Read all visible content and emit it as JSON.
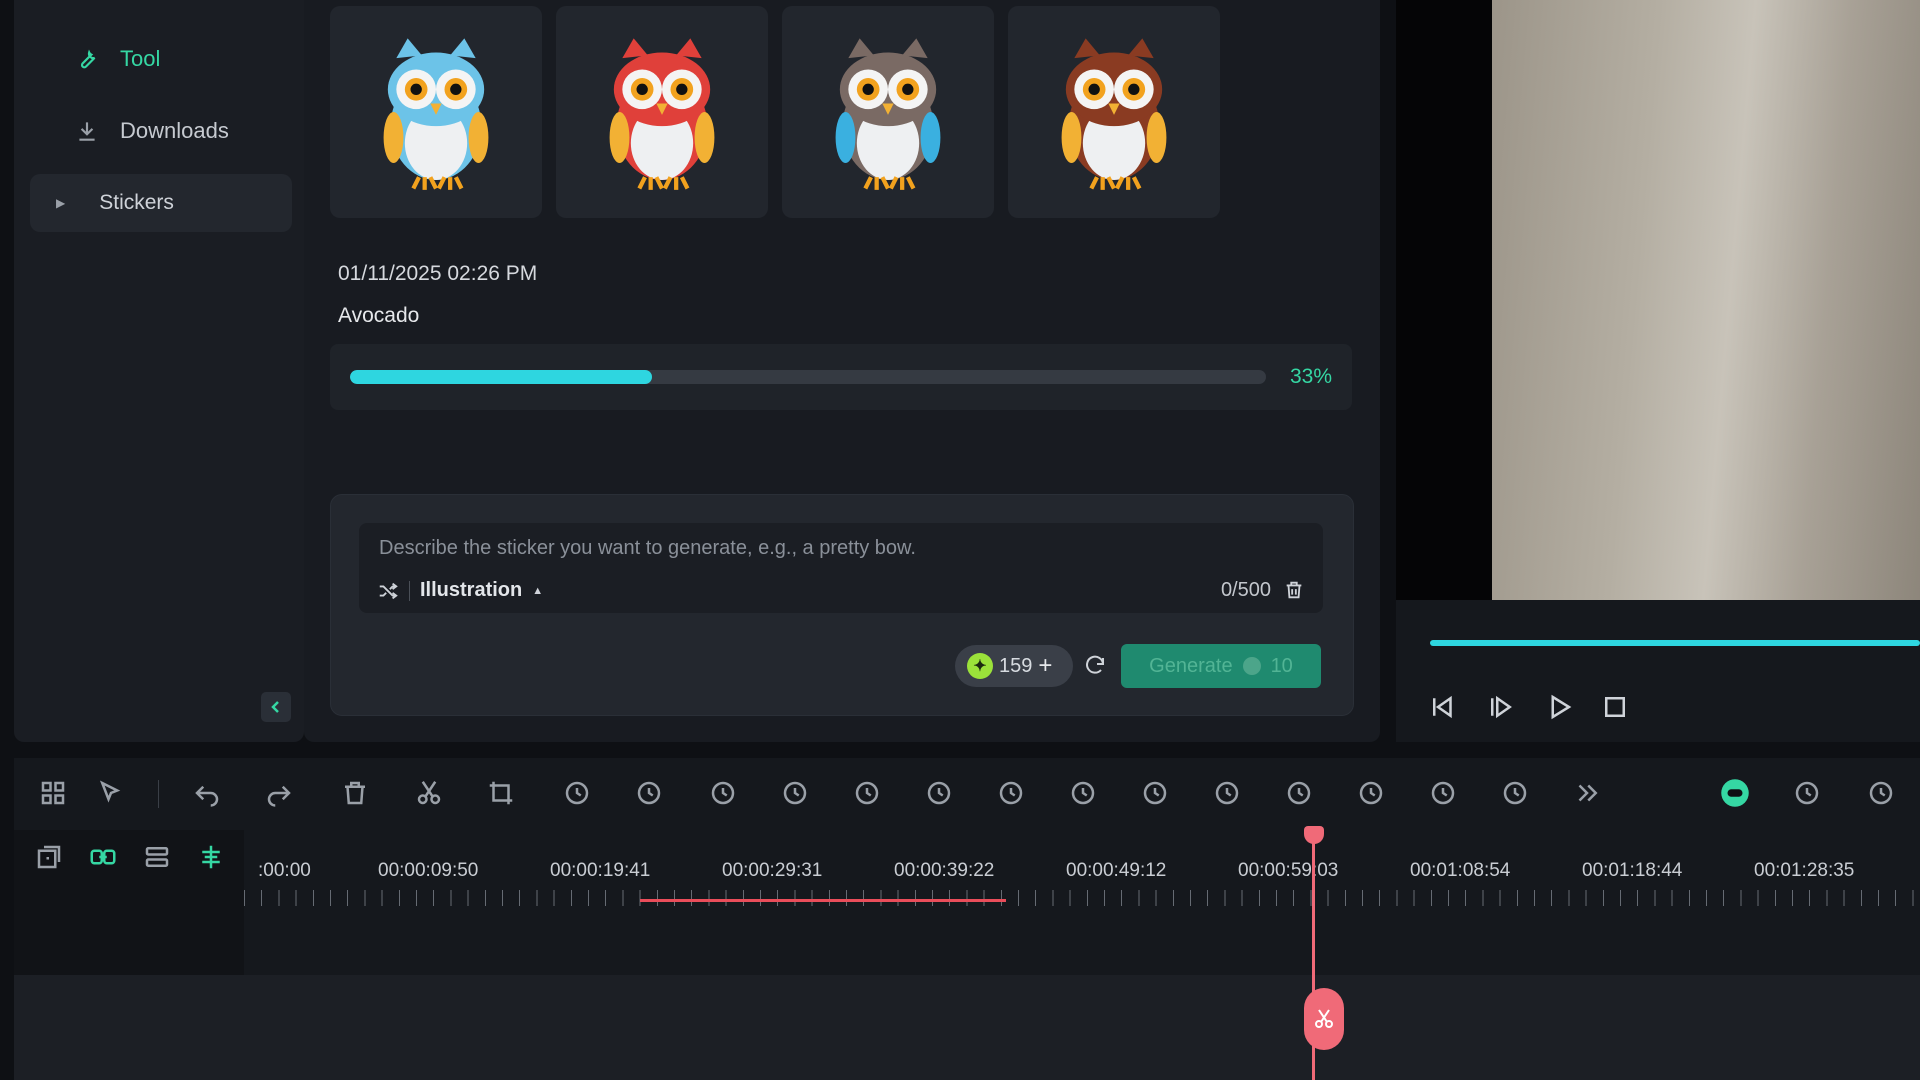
{
  "sidebar": {
    "items": [
      {
        "label": "Tool",
        "icon": "wrench-icon",
        "color": "#35d7a3"
      },
      {
        "label": "Downloads",
        "icon": "download-icon",
        "color": "#c6cad0"
      }
    ],
    "section": {
      "label": "Stickers",
      "icon": "caret-right-icon"
    },
    "collapse_icon": "chevron-left-icon"
  },
  "stickers": {
    "items": [
      {
        "name": "blue-owl",
        "body": "#6cc3e8",
        "accent": "#f2b134"
      },
      {
        "name": "red-owl",
        "body": "#e0403a",
        "accent": "#f2b134"
      },
      {
        "name": "gray-owl",
        "body": "#7a6a64",
        "accent": "#3ab0e0"
      },
      {
        "name": "brown-owl",
        "body": "#8a3b22",
        "accent": "#f2b134"
      }
    ],
    "date": "01/11/2025 02:26 PM",
    "name": "Avocado",
    "progress": {
      "value": 0.33,
      "label": "33%"
    }
  },
  "prompt": {
    "placeholder": "Describe the sticker you want to generate, e.g., a pretty bow.",
    "style": "Illustration",
    "counter": "0/500",
    "credits": "159",
    "generate_label": "Generate",
    "generate_cost": "10"
  },
  "timeline": {
    "timecodes": [
      ":00:00",
      "00:00:09:50",
      "00:00:19:41",
      "00:00:29:31",
      "00:00:39:22",
      "00:00:49:12",
      "00:00:59:03",
      "00:01:08:54",
      "00:01:18:44",
      "00:01:28:35"
    ]
  },
  "colors": {
    "accent": "#2ed6e0",
    "green": "#35d7a3",
    "playhead": "#f06a78"
  }
}
